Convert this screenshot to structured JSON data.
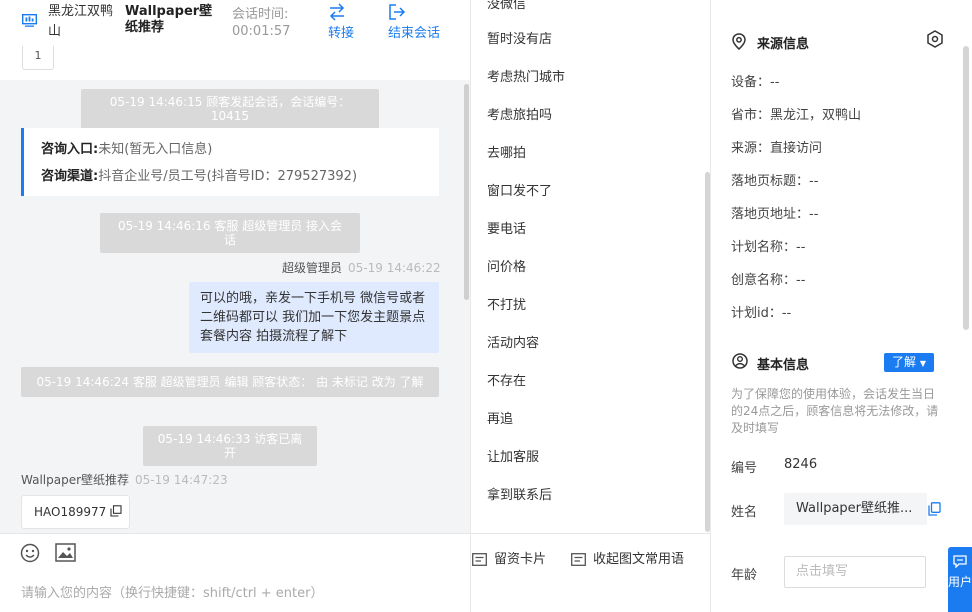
{
  "header": {
    "location": "黑龙江双鸭山",
    "visitor_title": "Wallpaper壁纸推荐",
    "session_time_label": "会话时间:",
    "session_time_value": "00:01:57",
    "transfer_label": "转接",
    "end_label": "结束会话"
  },
  "chat": {
    "page_number": "1",
    "sys1": "05-19 14:46:15 顾客发起会话，会话编号：10415",
    "card": {
      "entry_label": "咨询入口:",
      "entry_value": "未知(暂无入口信息)",
      "channel_label": "咨询渠道:",
      "channel_value": "抖音企业号/员工号(抖音号ID：279527392)"
    },
    "sys2": "05-19 14:46:16 客服 超级管理员 接入会话",
    "agent_name": "超级管理员",
    "agent_time": "05-19 14:46:22",
    "agent_message": "可以的哦，亲发一下手机号 微信号或者二维码都可以 我们加一下您发主题景点套餐内容 拍摄流程了解下",
    "sys3": "05-19 14:46:24 客服 超级管理员 编辑 顾客状态： 由 未标记 改为 了解",
    "sys4": "05-19 14:46:33 访客已离开",
    "visitor_name": "Wallpaper壁纸推荐",
    "visitor_time": "05-19 14:47:23",
    "visitor_message": "HAO189977",
    "input_placeholder": "请输入您的内容（换行快捷键：shift/ctrl + enter）"
  },
  "phrases": {
    "top_cut": "没微信",
    "items": [
      "暂时没有店",
      "考虑热门城市",
      "考虑旅拍吗",
      "去哪拍",
      "窗口发不了",
      "要电话",
      "问价格",
      "不打扰",
      "活动内容",
      "不存在",
      "再追",
      "让加客服",
      "拿到联系后"
    ],
    "card_label": "留资卡片",
    "collapse_label": "收起图文常用语"
  },
  "info": {
    "source_title": "来源信息",
    "source_fields": [
      "设备：--",
      "省市：黑龙江，双鸭山",
      "来源：直接访问",
      "落地页标题：--",
      "落地页地址：--",
      "计划名称：--",
      "创意名称：--",
      "计划id：--"
    ],
    "basic_title": "基本信息",
    "learn_label": "了解",
    "notice": "为了保障您的使用体验，会话发生当日的24点之后，顾客信息将无法修改，请及时填写",
    "id_label": "编号",
    "id_value": "8246",
    "name_label": "姓名",
    "name_value": "Wallpaper壁纸推...",
    "age_label": "年龄",
    "age_placeholder": "点击填写",
    "float_label": "用户"
  },
  "colors": {
    "accent": "#1a7cf0",
    "sys_msg_bg": "#d9d9d9",
    "agent_bubble": "#dfeaff"
  }
}
